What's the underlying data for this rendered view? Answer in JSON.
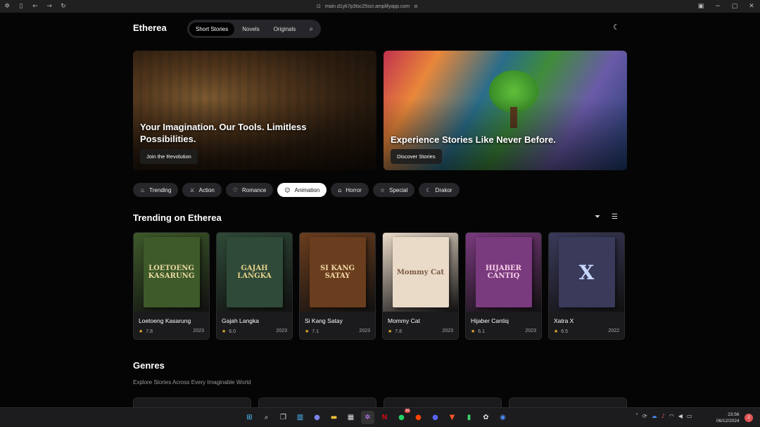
{
  "browser": {
    "url": "main.d1yk7p3tsc25scr.amplifyapp.com",
    "icons": [
      "app-icon",
      "sidebar-icon",
      "back-icon",
      "forward-icon",
      "refresh-icon"
    ]
  },
  "header": {
    "logo": "Etherea",
    "tabs": [
      {
        "label": "Short Stories",
        "active": true
      },
      {
        "label": "Novels",
        "active": false
      },
      {
        "label": "Originals",
        "active": false
      }
    ]
  },
  "hero": [
    {
      "title": "Your Imagination. Our Tools. Limitless Possibilities.",
      "button": "Join the Revolution"
    },
    {
      "title": "Experience Stories Like Never Before.",
      "button": "Discover Stories"
    }
  ],
  "genres_pills": [
    {
      "label": "Trending",
      "icon": "flame-icon",
      "active": false
    },
    {
      "label": "Action",
      "icon": "swords-icon",
      "active": false
    },
    {
      "label": "Romance",
      "icon": "heart-icon",
      "active": false
    },
    {
      "label": "Animation",
      "icon": "smile-icon",
      "active": true
    },
    {
      "label": "Horror",
      "icon": "ghost-icon",
      "active": false
    },
    {
      "label": "Special",
      "icon": "star-icon",
      "active": false
    },
    {
      "label": "Drakor",
      "icon": "moon-icon",
      "active": false
    }
  ],
  "trending": {
    "title": "Trending on Etherea",
    "items": [
      {
        "title": "Loetoeng Kasarung",
        "rating": "7.8",
        "year": "2023",
        "cover_text": "LOETOENG KASARUNG",
        "bg": "#3e5a2a",
        "fg": "#e8d9a0"
      },
      {
        "title": "Gajah Langka",
        "rating": "6.0",
        "year": "2023",
        "cover_text": "GAJAH LANGKA",
        "bg": "#2f4a38",
        "fg": "#e6d28a"
      },
      {
        "title": "Si Kang Satay",
        "rating": "7.1",
        "year": "2023",
        "cover_text": "SI KANG SATAY",
        "bg": "#6a3d1e",
        "fg": "#f2d9a8"
      },
      {
        "title": "Mommy Cat",
        "rating": "7.8",
        "year": "2023",
        "cover_text": "Mommy Cat",
        "bg": "#eadbc9",
        "fg": "#7a5a40"
      },
      {
        "title": "Hijaber Cantiq",
        "rating": "6.1",
        "year": "2023",
        "cover_text": "HIJABER CANTIQ",
        "bg": "#7a3a7e",
        "fg": "#f5d0e8"
      },
      {
        "title": "Xatra X",
        "rating": "6.5",
        "year": "2022",
        "cover_text": "X",
        "bg": "#3a3a5a",
        "fg": "#c8d8ff"
      }
    ]
  },
  "genres": {
    "title": "Genres",
    "subtitle": "Explore Stories Across Every Imaginable World"
  },
  "taskbar": {
    "time": "23:56",
    "date": "06/12/2024",
    "whatsapp_badge": "10",
    "notification_count": "2"
  }
}
